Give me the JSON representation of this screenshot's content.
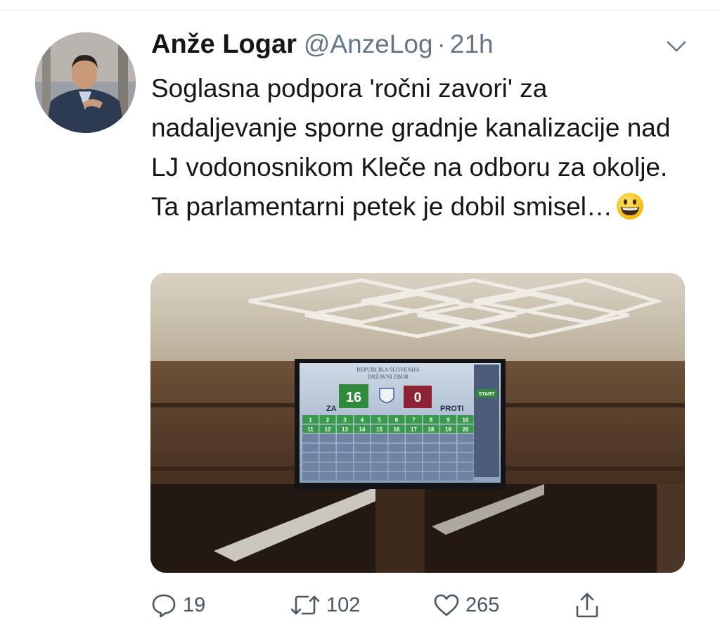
{
  "author": {
    "name": "Anže Logar",
    "handle": "@AnzeLog",
    "separator": "·",
    "time": "21h"
  },
  "tweet": {
    "text": "Soglasna podpora 'ročni zavori' za nadaljevanje sporne gradnje kanalizacije nad LJ vodonosnikom Kleče na odboru za okolje. Ta parlamentarni petek je dobil smisel…",
    "emoji": "grinning-face-icon"
  },
  "media": {
    "screen_header_line1": "REPUBLIKA SLOVENIJA",
    "screen_header_line2": "DRŽAVNI ZBOR",
    "za_label": "ZA",
    "proti_label": "PROTI",
    "za_count": "16",
    "proti_count": "0",
    "start_label": "START",
    "seat_numbers": [
      "1",
      "2",
      "3",
      "4",
      "5",
      "6",
      "7",
      "8",
      "9",
      "10",
      "11",
      "12",
      "13",
      "14",
      "15",
      "16",
      "17",
      "18",
      "19",
      "20"
    ]
  },
  "actions": {
    "replies": "19",
    "retweets": "102",
    "likes": "265"
  },
  "colors": {
    "text": "#14171a",
    "secondary": "#657786",
    "action_icon": "#4b5862",
    "za_green": "#2f8a3c",
    "proti_red": "#8b2335"
  }
}
